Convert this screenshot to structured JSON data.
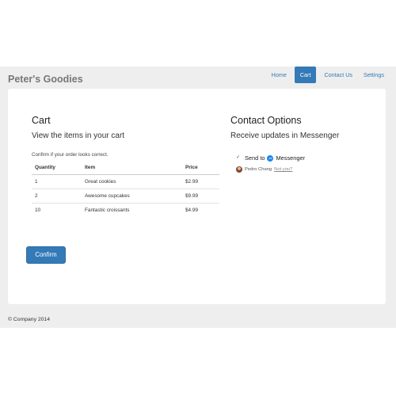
{
  "brand": "Peter's Goodies",
  "nav": {
    "items": [
      {
        "label": "Home",
        "active": false
      },
      {
        "label": "Cart",
        "active": true
      },
      {
        "label": "Contact Us",
        "active": false
      },
      {
        "label": "Settings",
        "active": false
      }
    ]
  },
  "cart": {
    "title": "Cart",
    "subtitle": "View the items in your cart",
    "note": "Confirm if your order looks correct.",
    "columns": [
      "Quantity",
      "Item",
      "Price"
    ],
    "rows": [
      {
        "quantity": "1",
        "item": "Great cookies",
        "price": "$2.99"
      },
      {
        "quantity": "2",
        "item": "Awesome cupcakes",
        "price": "$9.99"
      },
      {
        "quantity": "10",
        "item": "Fantastic croissants",
        "price": "$4.99"
      }
    ],
    "confirm_label": "Confirm"
  },
  "contact": {
    "title": "Contact Options",
    "subtitle": "Receive updates in Messenger",
    "checkbox_checked": true,
    "send_to_label": "Send to",
    "messenger_label": "Messenger",
    "user_name": "Pedro Chang",
    "not_you_label": "Not you?"
  },
  "footer": "© Company 2014",
  "colors": {
    "accent": "#337ab7",
    "messenger": "#1b86f5",
    "background": "#eeeeee"
  }
}
